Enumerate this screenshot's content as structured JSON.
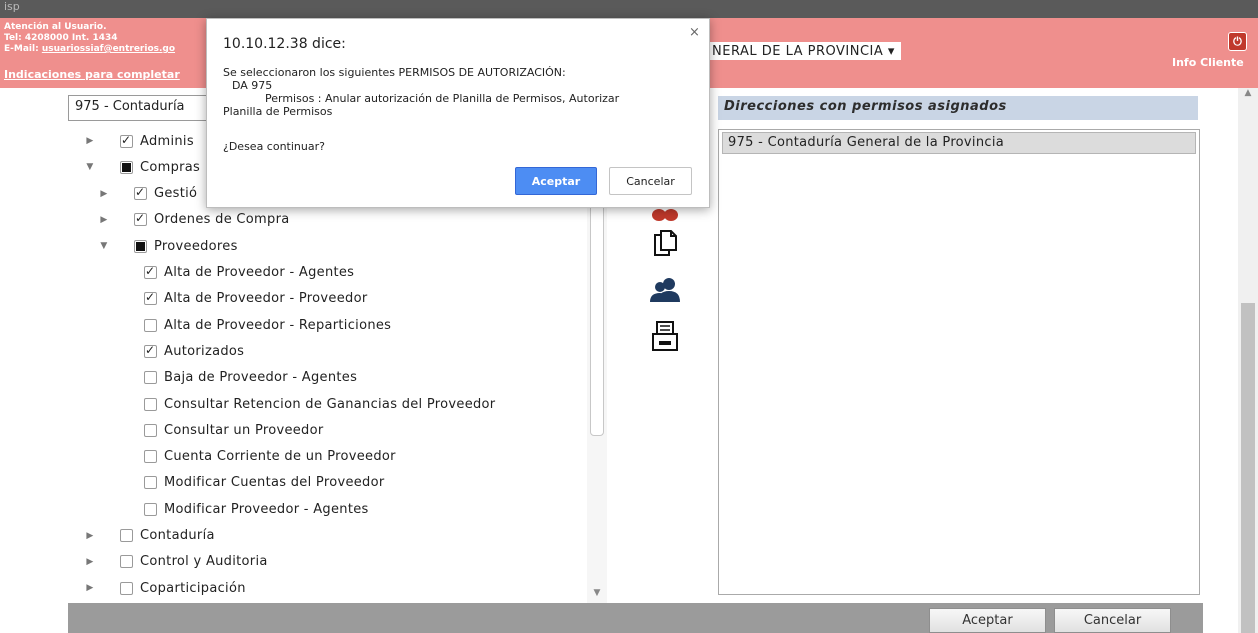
{
  "topbar": {
    "app_label": "isp"
  },
  "header": {
    "contact_line1": "Atención al Usuario.",
    "contact_line2": "Tel: 4208000 Int. 1434",
    "contact_line3_prefix": "E-Mail: ",
    "contact_email": "usuariossiaf@entrerios.go",
    "instructions_link": "Indicaciones para completar",
    "org_select": "NERAL DE LA PROVINCIA ▾",
    "info_client": "Info Cliente"
  },
  "left_panel": {
    "selected_org": "975 - Contaduría",
    "tree": [
      {
        "label": "Adminis",
        "level": 0,
        "arrow": "right",
        "check": "checked"
      },
      {
        "label": "Compras",
        "level": 0,
        "arrow": "down",
        "check": "partial"
      },
      {
        "label": "Gestió",
        "level": 1,
        "arrow": "right",
        "check": "checked"
      },
      {
        "label": "Ordenes de Compra",
        "level": 1,
        "arrow": "right",
        "check": "checked"
      },
      {
        "label": "Proveedores",
        "level": 1,
        "arrow": "down",
        "check": "partial"
      },
      {
        "label": "Alta de Proveedor - Agentes",
        "level": 2,
        "arrow": "none",
        "check": "checked"
      },
      {
        "label": "Alta de Proveedor - Proveedor",
        "level": 2,
        "arrow": "none",
        "check": "checked"
      },
      {
        "label": "Alta de Proveedor - Reparticiones",
        "level": 2,
        "arrow": "none",
        "check": "unchecked"
      },
      {
        "label": "Autorizados",
        "level": 2,
        "arrow": "none",
        "check": "checked"
      },
      {
        "label": "Baja de Proveedor - Agentes",
        "level": 2,
        "arrow": "none",
        "check": "unchecked"
      },
      {
        "label": "Consultar Retencion de Ganancias del Proveedor",
        "level": 2,
        "arrow": "none",
        "check": "unchecked"
      },
      {
        "label": "Consultar un Proveedor",
        "level": 2,
        "arrow": "none",
        "check": "unchecked"
      },
      {
        "label": "Cuenta Corriente de un Proveedor",
        "level": 2,
        "arrow": "none",
        "check": "unchecked"
      },
      {
        "label": "Modificar Cuentas del Proveedor",
        "level": 2,
        "arrow": "none",
        "check": "unchecked"
      },
      {
        "label": "Modificar Proveedor - Agentes",
        "level": 2,
        "arrow": "none",
        "check": "unchecked"
      },
      {
        "label": "Contaduría",
        "level": 0,
        "arrow": "right",
        "check": "unchecked"
      },
      {
        "label": "Control y Auditoria",
        "level": 0,
        "arrow": "right",
        "check": "unchecked"
      },
      {
        "label": "Coparticipación",
        "level": 0,
        "arrow": "right",
        "check": "unchecked"
      }
    ]
  },
  "middle_actions": [
    {
      "name": "remove-permissions-button",
      "icon": "scissors-icon"
    },
    {
      "name": "copy-permissions-button",
      "icon": "copy-document-icon"
    },
    {
      "name": "users-button",
      "icon": "users-icon"
    },
    {
      "name": "print-button",
      "icon": "printer-icon"
    }
  ],
  "right_panel": {
    "title": "Direcciones con permisos asignados",
    "items": [
      "975 - Contaduría General de la Provincia"
    ]
  },
  "footer": {
    "accept_label": "Aceptar",
    "cancel_label": "Cancelar"
  },
  "dialog": {
    "title": "10.10.12.38 dice:",
    "close_glyph": "×",
    "message_line1": "Se seleccionaron los siguientes PERMISOS DE AUTORIZACIÓN:",
    "message_line2": "DA 975",
    "message_line3": "Permisos : Anular autorización de Planilla de Permisos, Autorizar",
    "message_line4": "Planilla de Permisos",
    "question": "¿Desea continuar?",
    "ok_label": "Aceptar",
    "cancel_label": "Cancelar"
  },
  "colors": {
    "header_bg": "#ef8f8d",
    "dialog_ok": "#4d8df3",
    "panel_title_bg": "#c9d5e5"
  }
}
